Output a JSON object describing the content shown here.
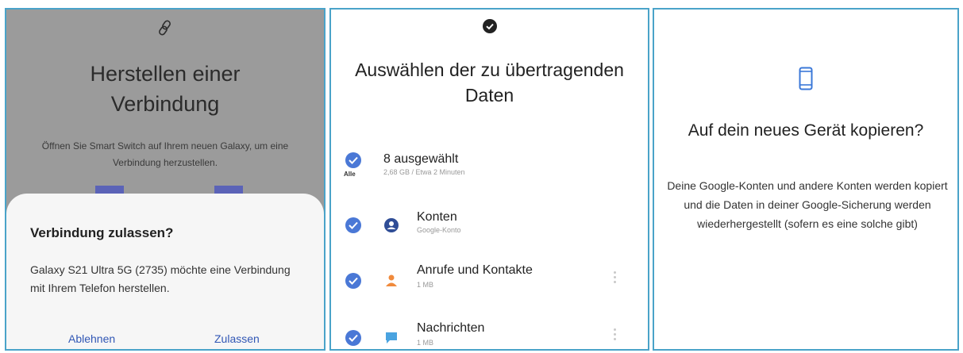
{
  "panel1": {
    "title": "Herstellen einer Verbindung",
    "subtitle": "Öffnen Sie Smart Switch auf Ihrem neuen Galaxy, um eine Verbindung herzustellen.",
    "dialog": {
      "title": "Verbindung zulassen?",
      "message": "Galaxy S21 Ultra 5G (2735) möchte eine Verbindung mit Ihrem Telefon herstellen.",
      "deny_label": "Ablehnen",
      "allow_label": "Zulassen"
    }
  },
  "panel2": {
    "title": "Auswählen der zu übertragenden Daten",
    "all_label": "Alle",
    "summary": {
      "title": "8 ausgewählt",
      "detail": "2,68 GB / Etwa 2 Minuten"
    },
    "items": [
      {
        "label": "Konten",
        "detail": "Google-Konto"
      },
      {
        "label": "Anrufe und Kontakte",
        "detail": "1 MB"
      },
      {
        "label": "Nachrichten",
        "detail": "1 MB"
      }
    ]
  },
  "panel3": {
    "title": "Auf dein neues Gerät kopieren?",
    "body": "Deine Google-Konten und andere Konten werden kopiert und die Daten in deiner Google-Sicherung werden wiederhergestellt (sofern es eine solche gibt)"
  },
  "colors": {
    "accent_blue": "#4a78d6",
    "link_blue": "#3157b5",
    "contacts_orange": "#f08a3c",
    "border": "#4aa3c9"
  },
  "icons": [
    "link-icon",
    "check-icon",
    "account-icon",
    "contacts-icon",
    "messages-icon",
    "phone-icon"
  ]
}
